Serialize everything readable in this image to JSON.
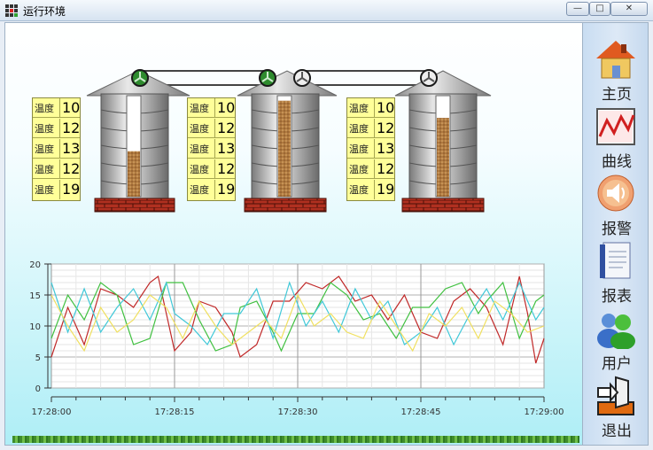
{
  "window": {
    "title": "运行环境",
    "minimize": "—",
    "maximize": "□",
    "close": "✕"
  },
  "sidebar": {
    "items": [
      {
        "label": "主页",
        "icon": "home-icon"
      },
      {
        "label": "曲线",
        "icon": "curve-chart-icon"
      },
      {
        "label": "报警",
        "icon": "alarm-speaker-icon"
      },
      {
        "label": "报表",
        "icon": "report-icon"
      },
      {
        "label": "用户",
        "icon": "users-icon"
      },
      {
        "label": "退出",
        "icon": "exit-icon"
      }
    ]
  },
  "silos": [
    {
      "temps": [
        {
          "label": "温度",
          "value": "10"
        },
        {
          "label": "温度",
          "value": "12"
        },
        {
          "label": "温度",
          "value": "13"
        },
        {
          "label": "温度",
          "value": "12"
        },
        {
          "label": "温度",
          "value": "19"
        }
      ],
      "fill_level": 0.45
    },
    {
      "temps": [
        {
          "label": "温度",
          "value": "10"
        },
        {
          "label": "温度",
          "value": "12"
        },
        {
          "label": "温度",
          "value": "13"
        },
        {
          "label": "温度",
          "value": "12"
        },
        {
          "label": "温度",
          "value": "19"
        }
      ],
      "fill_level": 0.95
    },
    {
      "temps": [
        {
          "label": "温度",
          "value": "10"
        },
        {
          "label": "温度",
          "value": "12"
        },
        {
          "label": "温度",
          "value": "13"
        },
        {
          "label": "温度",
          "value": "12"
        },
        {
          "label": "温度",
          "value": "19"
        }
      ],
      "fill_level": 0.78
    }
  ],
  "chart_data": {
    "type": "line",
    "ylim": [
      0,
      20
    ],
    "yticks": [
      "0",
      "5",
      "10",
      "15",
      "20"
    ],
    "xticks": [
      "17:28:00",
      "17:28:15",
      "17:28:30",
      "17:28:45",
      "17:29:00"
    ],
    "xlim": [
      0,
      60
    ],
    "grid": true,
    "series": [
      {
        "color": "#c02828",
        "values": [
          [
            0,
            5
          ],
          [
            2,
            13
          ],
          [
            4,
            7
          ],
          [
            6,
            16
          ],
          [
            8,
            15
          ],
          [
            10,
            13
          ],
          [
            12,
            17
          ],
          [
            13,
            18
          ],
          [
            15,
            6
          ],
          [
            17,
            9
          ],
          [
            18,
            14
          ],
          [
            20,
            13
          ],
          [
            22,
            9
          ],
          [
            23,
            5
          ],
          [
            25,
            7
          ],
          [
            27,
            14
          ],
          [
            29,
            14
          ],
          [
            31,
            17
          ],
          [
            33,
            16
          ],
          [
            35,
            18
          ],
          [
            37,
            14
          ],
          [
            39,
            15
          ],
          [
            41,
            11
          ],
          [
            43,
            15
          ],
          [
            45,
            9
          ],
          [
            47,
            8
          ],
          [
            49,
            14
          ],
          [
            51,
            16
          ],
          [
            53,
            13
          ],
          [
            55,
            7
          ],
          [
            57,
            18
          ],
          [
            58,
            12
          ],
          [
            59,
            4
          ],
          [
            60,
            8
          ]
        ]
      },
      {
        "color": "#40c040",
        "values": [
          [
            0,
            8
          ],
          [
            2,
            15
          ],
          [
            4,
            11
          ],
          [
            6,
            17
          ],
          [
            8,
            15
          ],
          [
            10,
            7
          ],
          [
            12,
            8
          ],
          [
            14,
            17
          ],
          [
            16,
            17
          ],
          [
            18,
            11
          ],
          [
            20,
            6
          ],
          [
            22,
            7
          ],
          [
            23,
            13
          ],
          [
            25,
            14
          ],
          [
            27,
            9
          ],
          [
            28,
            6
          ],
          [
            30,
            12
          ],
          [
            32,
            12
          ],
          [
            34,
            17
          ],
          [
            36,
            15
          ],
          [
            38,
            11
          ],
          [
            40,
            12
          ],
          [
            42,
            8
          ],
          [
            44,
            13
          ],
          [
            46,
            13
          ],
          [
            48,
            16
          ],
          [
            50,
            17
          ],
          [
            52,
            12
          ],
          [
            53,
            14
          ],
          [
            55,
            17
          ],
          [
            57,
            8
          ],
          [
            59,
            14
          ],
          [
            60,
            15
          ]
        ]
      },
      {
        "color": "#40c8d8",
        "values": [
          [
            0,
            17
          ],
          [
            2,
            9
          ],
          [
            4,
            16
          ],
          [
            6,
            9
          ],
          [
            8,
            13
          ],
          [
            10,
            16
          ],
          [
            12,
            11
          ],
          [
            14,
            17
          ],
          [
            15,
            12
          ],
          [
            17,
            10
          ],
          [
            19,
            7
          ],
          [
            21,
            12
          ],
          [
            23,
            12
          ],
          [
            25,
            16
          ],
          [
            27,
            8
          ],
          [
            29,
            17
          ],
          [
            31,
            10
          ],
          [
            33,
            14
          ],
          [
            35,
            9
          ],
          [
            37,
            16
          ],
          [
            39,
            11
          ],
          [
            41,
            14
          ],
          [
            43,
            7
          ],
          [
            45,
            9
          ],
          [
            47,
            13
          ],
          [
            49,
            7
          ],
          [
            51,
            12
          ],
          [
            53,
            16
          ],
          [
            55,
            11
          ],
          [
            57,
            17
          ],
          [
            59,
            11
          ],
          [
            60,
            13
          ]
        ]
      },
      {
        "color": "#f0e060",
        "values": [
          [
            0,
            15
          ],
          [
            2,
            10
          ],
          [
            4,
            6
          ],
          [
            6,
            13
          ],
          [
            8,
            9
          ],
          [
            10,
            11
          ],
          [
            12,
            15
          ],
          [
            14,
            13
          ],
          [
            16,
            8
          ],
          [
            18,
            14
          ],
          [
            20,
            10
          ],
          [
            22,
            7
          ],
          [
            24,
            9
          ],
          [
            26,
            11
          ],
          [
            28,
            8
          ],
          [
            30,
            15
          ],
          [
            32,
            10
          ],
          [
            34,
            12
          ],
          [
            36,
            9
          ],
          [
            38,
            8
          ],
          [
            40,
            14
          ],
          [
            42,
            10
          ],
          [
            44,
            6
          ],
          [
            46,
            12
          ],
          [
            48,
            10
          ],
          [
            50,
            13
          ],
          [
            52,
            8
          ],
          [
            54,
            14
          ],
          [
            56,
            12
          ],
          [
            58,
            9
          ],
          [
            60,
            10
          ]
        ]
      }
    ]
  }
}
